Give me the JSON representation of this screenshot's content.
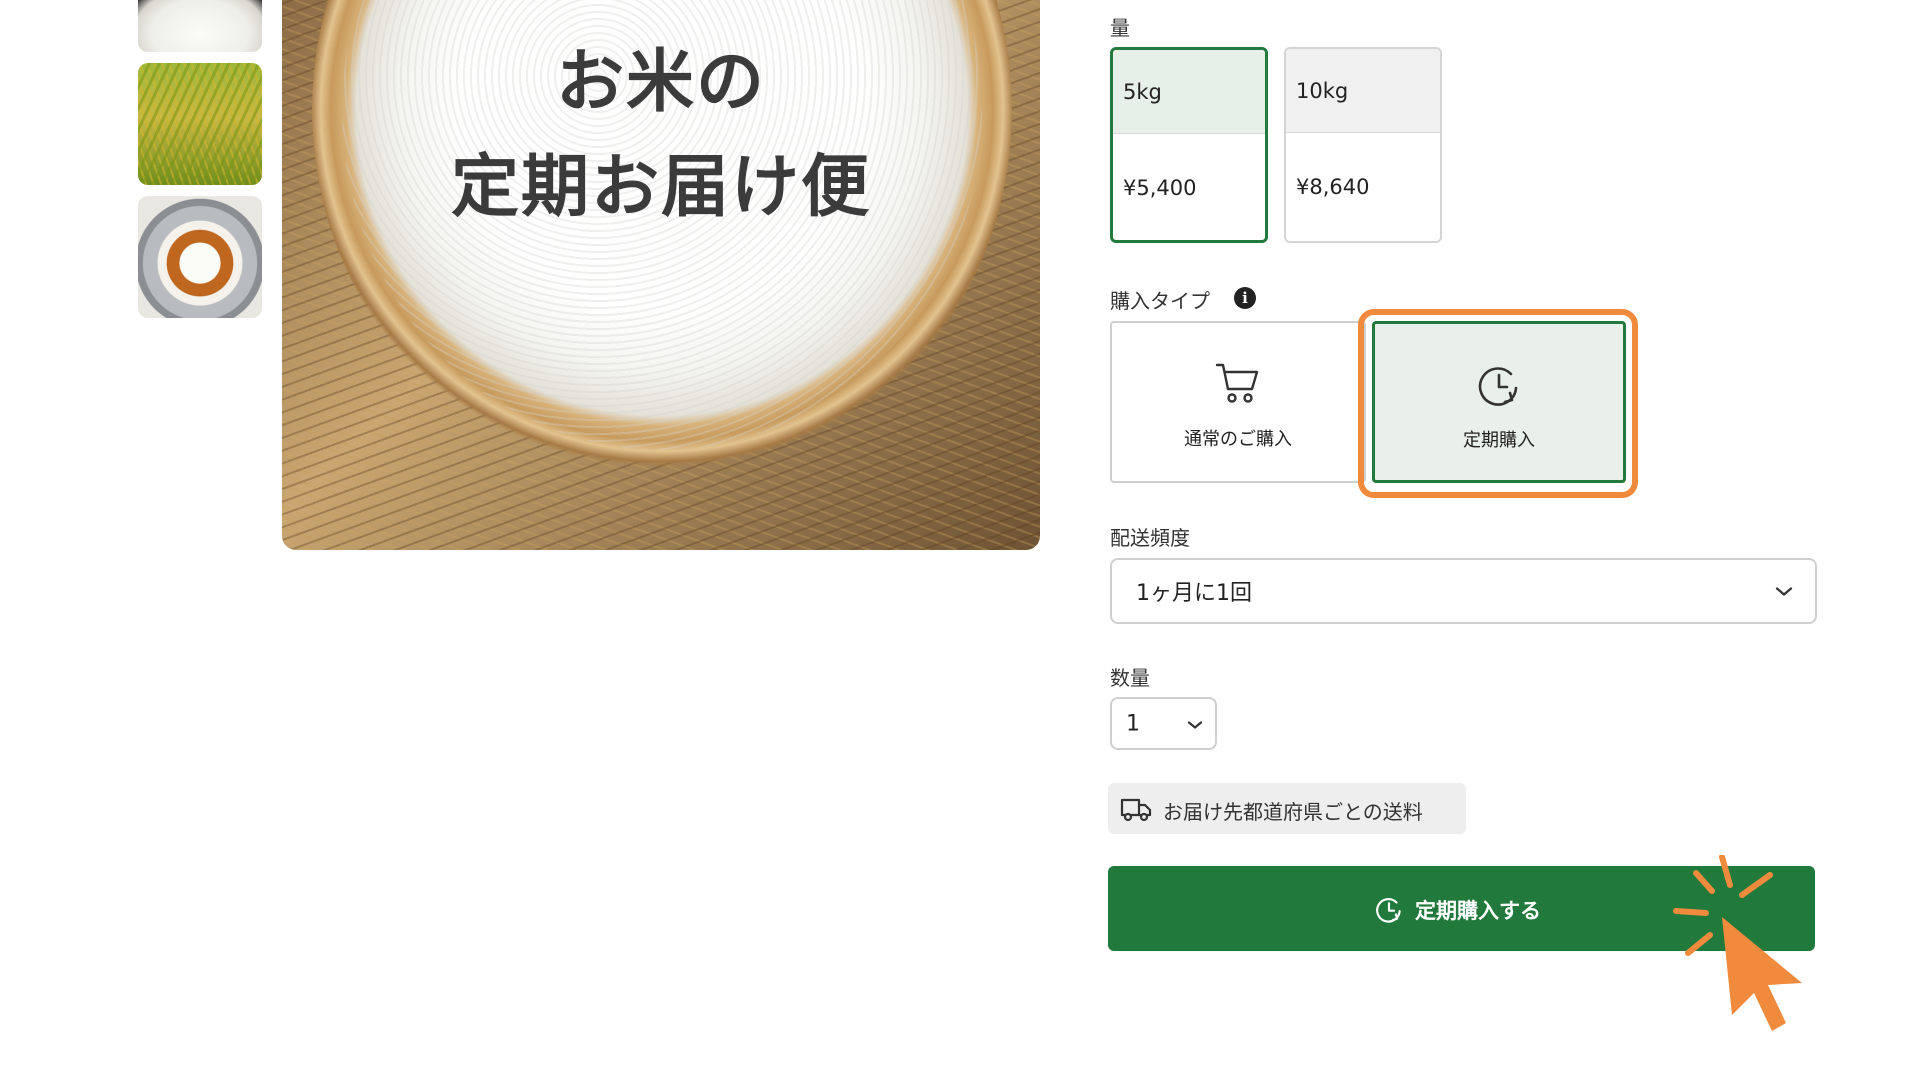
{
  "hero": {
    "title_line1": "お米の",
    "title_line2": "定期お届け便"
  },
  "quantity_section": {
    "label": "量",
    "options": [
      {
        "amount": "5kg",
        "price": "¥5,400",
        "selected": true
      },
      {
        "amount": "10kg",
        "price": "¥8,640",
        "selected": false
      }
    ]
  },
  "purchase_type": {
    "label": "購入タイプ",
    "options": [
      {
        "label": "通常のご購入",
        "icon": "cart-icon",
        "selected": false
      },
      {
        "label": "定期購入",
        "icon": "clock-refresh-icon",
        "selected": true
      }
    ]
  },
  "delivery_frequency": {
    "label": "配送頻度",
    "value": "1ヶ月に1回"
  },
  "count": {
    "label": "数量",
    "value": "1"
  },
  "shipping_link": {
    "label": "お届け先都道府県ごとの送料",
    "icon": "truck-icon"
  },
  "buy_button": {
    "label": "定期購入する",
    "icon": "clock-refresh-icon"
  },
  "colors": {
    "accent_green": "#217a3c",
    "highlight_orange": "#f08a3c"
  }
}
